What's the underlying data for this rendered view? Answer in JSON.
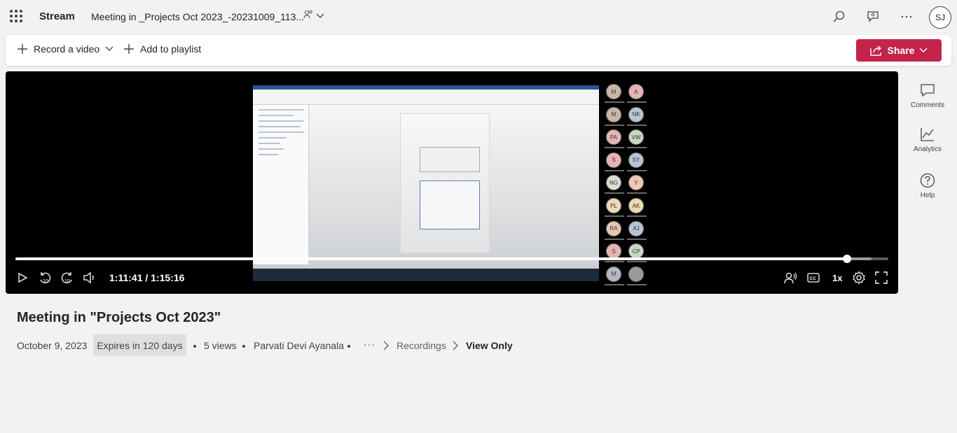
{
  "app": {
    "name": "Stream",
    "file_title": "Meeting in _Projects Oct 2023_-20231009_113...",
    "user_initials": "SJ"
  },
  "icons": {
    "app_launcher": "waffle-icon",
    "search": "search-icon",
    "feedback": "feedback-icon",
    "more": "more-icon",
    "shared": "people-icon"
  },
  "commands": {
    "record_label": "Record a video",
    "playlist_label": "Add to playlist",
    "share_label": "Share"
  },
  "player": {
    "time_display": "1:11:41 / 1:15:16",
    "speed": "1x",
    "progress_fraction": 0.953,
    "buffered_fraction": 0.981,
    "participants": [
      "M",
      "A",
      "M",
      "NK",
      "PA",
      "VW",
      "S",
      "SY",
      "NG",
      "Y",
      "PL",
      "AK",
      "RA",
      "AJ",
      "S",
      "CP",
      "M",
      ""
    ]
  },
  "rail": {
    "comments_label": "Comments",
    "analytics_label": "Analytics",
    "help_label": "Help"
  },
  "video": {
    "title": "Meeting in \"Projects Oct 2023\"",
    "date": "October 9, 2023",
    "expires": "Expires in 120 days",
    "views": "5 views",
    "owner": "Parvati Devi Ayanala",
    "breadcrumb_more": "···",
    "breadcrumb_folder": "Recordings",
    "permission": "View Only"
  },
  "colors": {
    "accent": "#c4234a",
    "page_bg": "#f3f2f1",
    "player_bg": "#000000"
  }
}
